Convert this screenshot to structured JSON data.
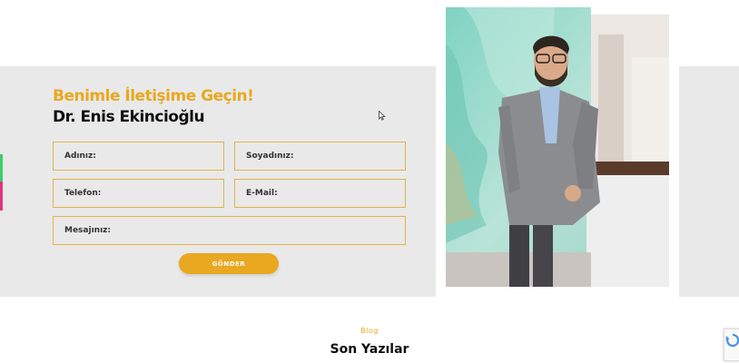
{
  "contact": {
    "heading_line1": "Benimle İletişime Geçin!",
    "heading_line2": "Dr. Enis Ekincioğlu",
    "fields": {
      "name_placeholder": "Adınız:",
      "surname_placeholder": "Soyadınız:",
      "phone_placeholder": "Telefon:",
      "email_placeholder": "E-Mail:",
      "message_placeholder": "Mesajınız:"
    },
    "submit_label": "GÖNDER"
  },
  "blog": {
    "label": "Blog",
    "title": "Son Yazılar"
  },
  "colors": {
    "accent": "#e8a820",
    "panel": "#e9e9e9",
    "field_border": "#e3b34a",
    "side_tab_green": "#3bcf6a",
    "side_tab_pink": "#e2337a"
  },
  "icons": {
    "cursor": "mouse-pointer-icon",
    "recaptcha": "recaptcha-icon"
  }
}
